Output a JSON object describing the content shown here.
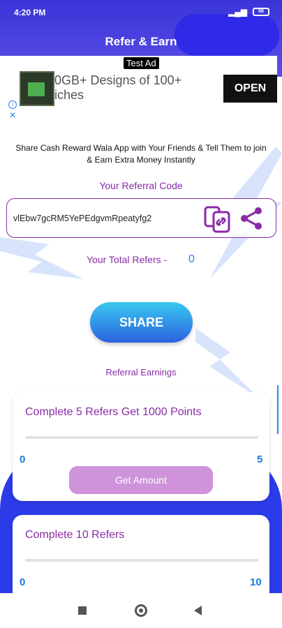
{
  "status_bar": {
    "time": "4:20 PM",
    "battery": "68"
  },
  "header": {
    "title": "Refer & Earn"
  },
  "ad": {
    "tag": "Test Ad",
    "headline_line1": "0GB+ Designs of 100+",
    "headline_line2": "iches",
    "cta": "OPEN",
    "info_icon": "i",
    "close_icon": "✕"
  },
  "description": "Share Cash Reward Wala App with Your Friends & Tell Them to join & Earn Extra Money Instantly",
  "referral": {
    "label": "Your Referral Code",
    "code": "vlEbw7gcRM5YePEdgvmRpeatyfg2"
  },
  "total_refers": {
    "label": "Your Total Refers -",
    "value": "0"
  },
  "share_button": "SHARE",
  "earnings_label": "Referral Earnings",
  "cards": [
    {
      "title": "Complete 5 Refers Get 1000 Points",
      "min": "0",
      "max": "5",
      "progress": 0,
      "button": "Get Amount"
    },
    {
      "title": "Complete 10 Refers",
      "min": "0",
      "max": "10",
      "progress": 0
    }
  ],
  "colors": {
    "primary": "#3a34d8",
    "accent_purple": "#8a2aa8",
    "accent_blue": "#2b82f6",
    "button_disabled": "#cf93dc"
  }
}
